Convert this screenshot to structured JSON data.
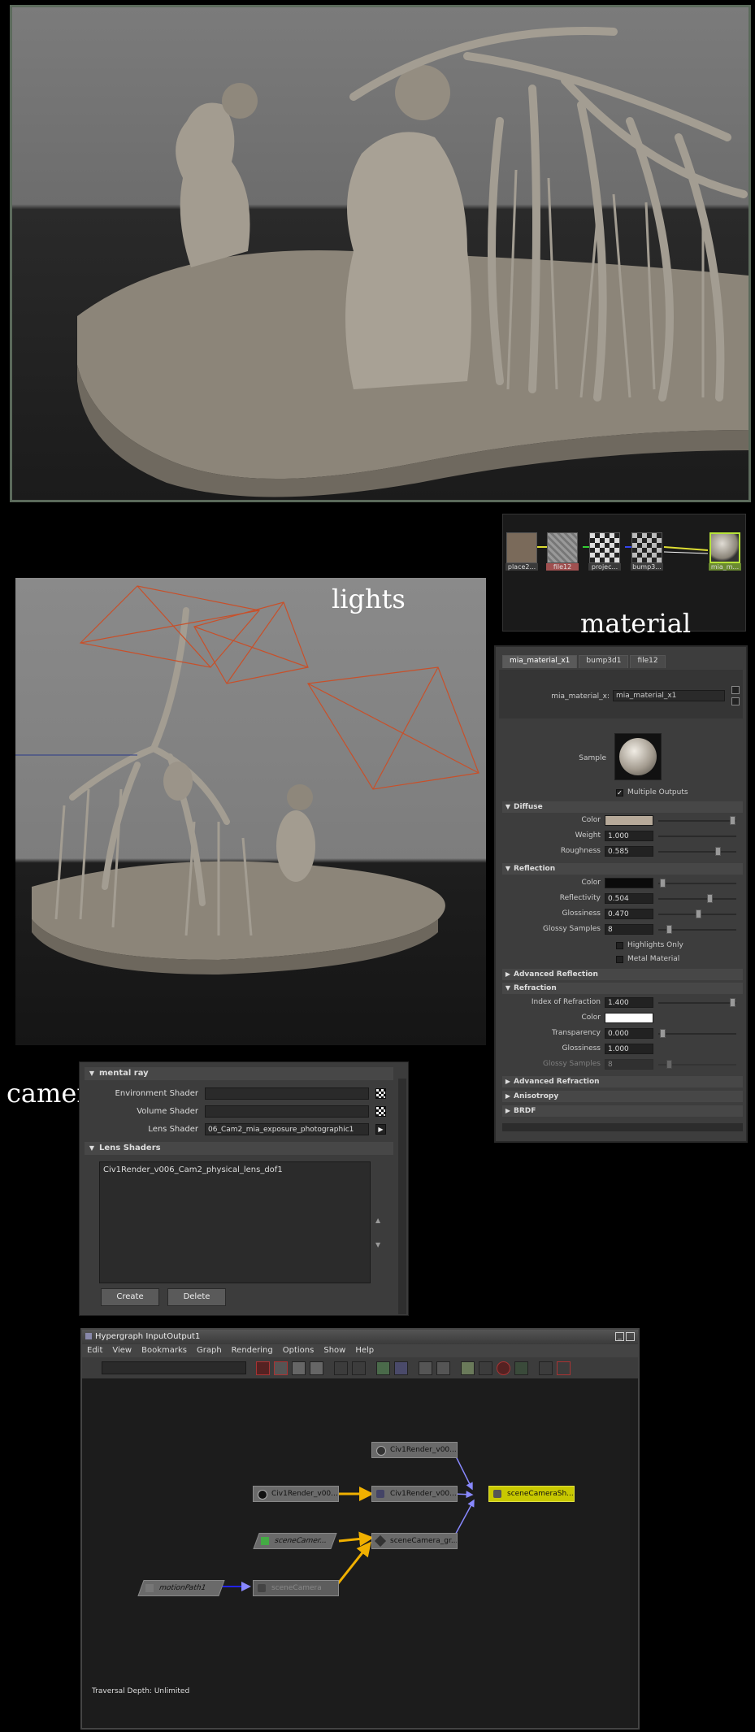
{
  "labels": {
    "lights": "lights",
    "material": "material",
    "camera": "camera"
  },
  "swatches": [
    {
      "label": "place2...",
      "color": "#7a6a5a"
    },
    {
      "label": "file12",
      "color": "#8a8a8a"
    },
    {
      "label": "projec...",
      "color": "#444444"
    },
    {
      "label": "bump3...",
      "color": "#333333"
    },
    {
      "label": "mia_m...",
      "color": "#9a9080"
    }
  ],
  "attribute_editor": {
    "tabs": [
      "mia_material_x1",
      "bump3d1",
      "file12"
    ],
    "node_label": "mia_material_x:",
    "node_value": "mia_material_x1",
    "sample_label": "Sample",
    "multiple_outputs": "Multiple Outputs",
    "sections": {
      "diffuse": "Diffuse",
      "reflection": "Reflection",
      "adv_reflection": "Advanced Reflection",
      "refraction": "Refraction",
      "adv_refraction": "Advanced Refraction",
      "anisotropy": "Anisotropy",
      "brdf": "BRDF"
    },
    "diffuse": {
      "color_label": "Color",
      "color": "#b7aa9a",
      "weight_label": "Weight",
      "weight": "1.000",
      "weight_level": 1.0,
      "roughness_label": "Roughness",
      "roughness": "0.585",
      "roughness_level": 0.585
    },
    "reflection": {
      "color_label": "Color",
      "color": "#0a0a0a",
      "reflectivity_label": "Reflectivity",
      "reflectivity": "0.504",
      "reflectivity_level": 0.504,
      "glossiness_label": "Glossiness",
      "glossiness": "0.470",
      "glossiness_level": 0.47,
      "glossy_samples_label": "Glossy Samples",
      "glossy_samples": "8",
      "highlights_only": "Highlights Only",
      "metal_material": "Metal Material"
    },
    "refraction": {
      "ior_label": "Index of Refraction",
      "ior": "1.400",
      "color_label": "Color",
      "color": "#ffffff",
      "transparency_label": "Transparency",
      "transparency": "0.000",
      "glossiness_label": "Glossiness",
      "glossiness": "1.000",
      "glossy_samples_label": "Glossy Samples",
      "glossy_samples": "8"
    }
  },
  "mental_ray": {
    "section": "mental ray",
    "environment_shader": "Environment Shader",
    "volume_shader": "Volume Shader",
    "lens_shader": "Lens Shader",
    "lens_shader_value": "06_Cam2_mia_exposure_photographic1",
    "lens_shaders_section": "Lens Shaders",
    "lens_list": [
      "Civ1Render_v006_Cam2_physical_lens_dof1"
    ],
    "create": "Create",
    "delete": "Delete"
  },
  "hypergraph": {
    "title": "Hypergraph InputOutput1",
    "menu": [
      "Edit",
      "View",
      "Bookmarks",
      "Graph",
      "Rendering",
      "Options",
      "Show",
      "Help"
    ],
    "nodes": {
      "n_top": "Civ1Render_v00...",
      "n_left": "Civ1Render_v00...",
      "n_mid": "Civ1Render_v00...",
      "n_sel": "sceneCameraSh...",
      "n_scene_l": "sceneCamer...",
      "n_scene_gr": "sceneCamera_gr...",
      "n_motion": "motionPath1",
      "n_scenecam": "sceneCamera"
    },
    "footer": "Traversal Depth: Unlimited"
  }
}
